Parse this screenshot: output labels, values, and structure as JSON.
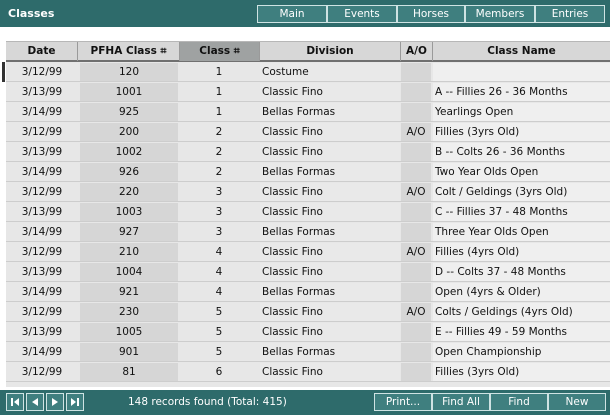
{
  "window": {
    "title": "Classes"
  },
  "nav": [
    "Main",
    "Events",
    "Horses",
    "Members",
    "Entries"
  ],
  "columns": [
    "Date",
    "PFHA Class ⌗",
    "Class ⌗",
    "Division",
    "A/O",
    "Class Name"
  ],
  "rows": [
    [
      "3/12/99",
      "120",
      "1",
      "Costume",
      "",
      ""
    ],
    [
      "3/13/99",
      "1001",
      "1",
      "Classic Fino",
      "",
      "A -- Fillies 26 - 36 Months"
    ],
    [
      "3/14/99",
      "925",
      "1",
      "Bellas Formas",
      "",
      "Yearlings Open"
    ],
    [
      "3/12/99",
      "200",
      "2",
      "Classic Fino",
      "A/O",
      "Fillies (3yrs Old)"
    ],
    [
      "3/13/99",
      "1002",
      "2",
      "Classic Fino",
      "",
      "B -- Colts 26 - 36 Months"
    ],
    [
      "3/14/99",
      "926",
      "2",
      "Bellas Formas",
      "",
      "Two Year Olds Open"
    ],
    [
      "3/12/99",
      "220",
      "3",
      "Classic Fino",
      "A/O",
      "Colt / Geldings (3yrs Old)"
    ],
    [
      "3/13/99",
      "1003",
      "3",
      "Classic Fino",
      "",
      "C -- Fillies 37 - 48 Months"
    ],
    [
      "3/14/99",
      "927",
      "3",
      "Bellas Formas",
      "",
      "Three Year Olds Open"
    ],
    [
      "3/12/99",
      "210",
      "4",
      "Classic Fino",
      "A/O",
      "Fillies (4yrs Old)"
    ],
    [
      "3/13/99",
      "1004",
      "4",
      "Classic Fino",
      "",
      "D -- Colts 37 - 48 Months"
    ],
    [
      "3/14/99",
      "921",
      "4",
      "Bellas Formas",
      "",
      "Open (4yrs & Older)"
    ],
    [
      "3/12/99",
      "230",
      "5",
      "Classic Fino",
      "A/O",
      "Colts / Geldings (4yrs Old)"
    ],
    [
      "3/13/99",
      "1005",
      "5",
      "Classic Fino",
      "",
      "E -- Fillies 49 - 59 Months"
    ],
    [
      "3/14/99",
      "901",
      "5",
      "Bellas Formas",
      "",
      "Open Championship"
    ],
    [
      "3/12/99",
      "81",
      "6",
      "Classic Fino",
      "",
      "Fillies (3yrs Old)"
    ]
  ],
  "footer": {
    "records": "148 records found  (Total: 415)",
    "buttons": [
      "Print...",
      "Find All",
      "Find",
      "New"
    ]
  },
  "icons": [
    "first-record-icon",
    "previous-record-icon",
    "next-record-icon",
    "last-record-icon"
  ],
  "colors": {
    "bar": "#2e6b6b",
    "button": "#3f7f7f",
    "header": "#d7d7d7",
    "sorted_header": "#9fa2a2"
  }
}
